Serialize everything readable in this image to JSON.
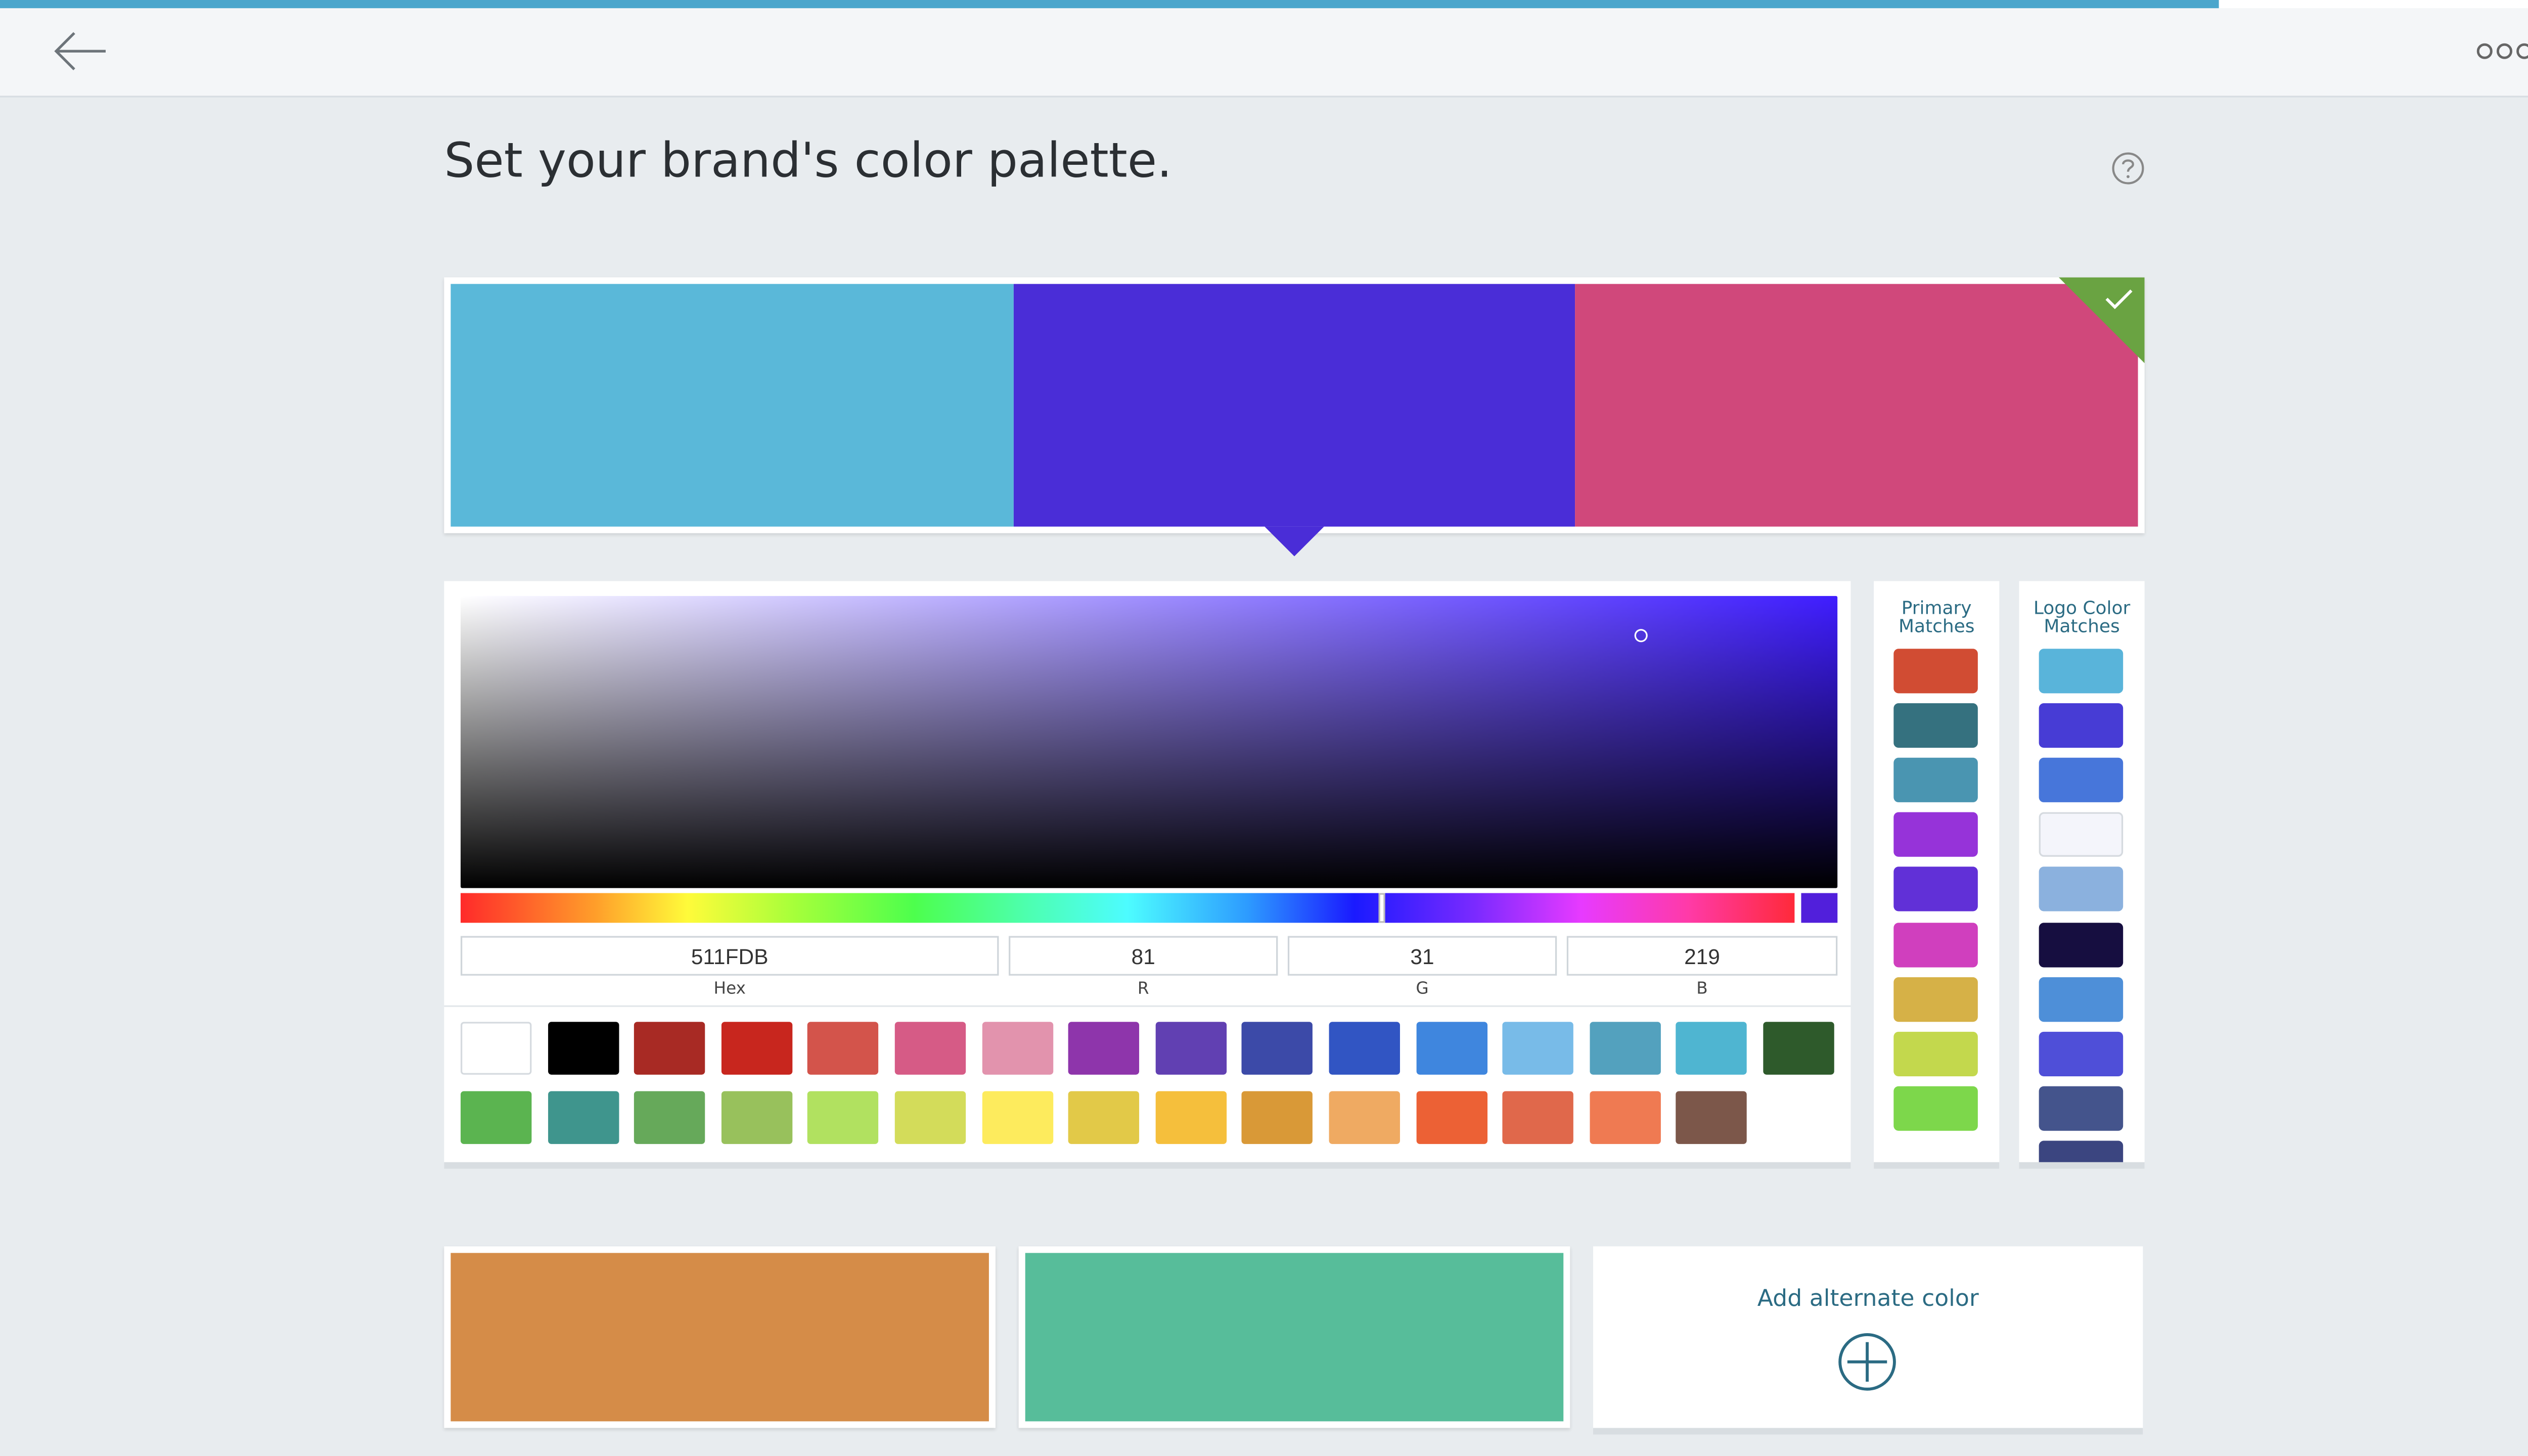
{
  "progress": {
    "percent": 85.7
  },
  "header": {
    "back_icon": "arrow-left-icon",
    "more_icon": "more-dots-icon"
  },
  "page": {
    "title": "Set your brand's color palette.",
    "help_icon": "help-icon"
  },
  "primary_palette": {
    "selected_index": 1,
    "selected_badge_icon": "check-icon",
    "selected_badge_color": "#6aa342",
    "colors": [
      "#5ab8d9",
      "#4a2dd7",
      "#d0487b"
    ]
  },
  "picker": {
    "hue_base": "#3f1dff",
    "hue_fraction": 0.69,
    "saturation": 0.86,
    "value": 0.86,
    "current_color": "#511fdb",
    "hex": {
      "value": "511FDB",
      "label": "Hex"
    },
    "r": {
      "value": "81",
      "label": "R"
    },
    "g": {
      "value": "31",
      "label": "G"
    },
    "b": {
      "value": "219",
      "label": "B"
    },
    "presets": [
      [
        "#ffffff",
        "#000000",
        "#a82a24",
        "#c8261e",
        "#d3544b",
        "#d65b86",
        "#e293ad",
        "#8e35ab",
        "#6140b2",
        "#3c4aa8",
        "#3155c3",
        "#3f86de",
        "#78bbe8",
        "#53a1be",
        "#4fb5d1",
        "#2e5a2b"
      ],
      [
        "#5bb450",
        "#3f958d",
        "#66a95a",
        "#98c15c",
        "#b1e160",
        "#d3dc5a",
        "#fdeb5d",
        "#e2c948",
        "#f5bf3c",
        "#d99937",
        "#efaa62",
        "#ec6135",
        "#e0684b",
        "#ef7a52",
        "#7c574a"
      ]
    ]
  },
  "primary_matches": {
    "title_line1": "Primary",
    "title_line2": "Matches",
    "colors": [
      "#d14c33",
      "#35717f",
      "#4a95b1",
      "#9633d9",
      "#6130d7",
      "#d03fbe",
      "#d6b147",
      "#c3d84d",
      "#7dd74b"
    ]
  },
  "logo_matches": {
    "title_line1": "Logo Color",
    "title_line2": "Matches",
    "colors": [
      "#59b4da",
      "#473cd5",
      "#4776da",
      "#f4f5fb",
      "#8bb1de",
      "#160e40",
      "#4e8fd8",
      "#4f4fd8",
      "#44548c",
      "#3b4580"
    ]
  },
  "alternate": {
    "colors": [
      "#d58c48",
      "#57bd9a"
    ],
    "add_label": "Add alternate color",
    "add_icon": "plus-circle-icon"
  }
}
